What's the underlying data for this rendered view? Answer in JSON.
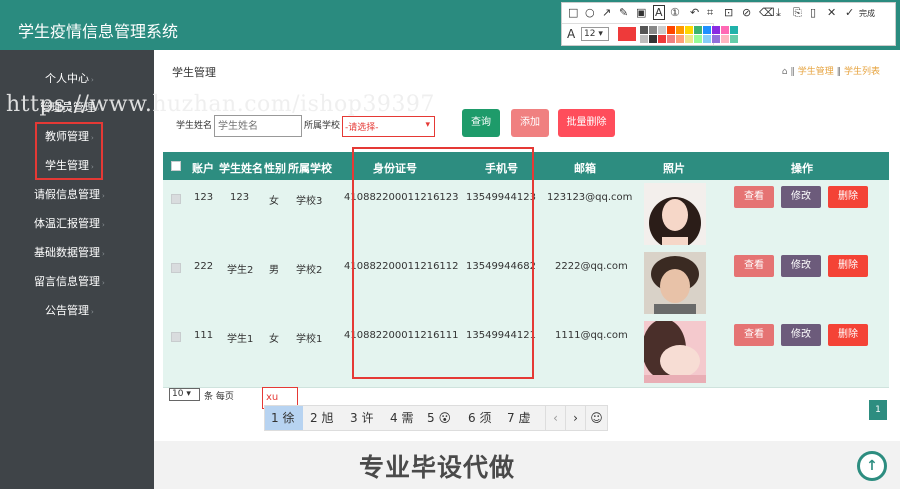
{
  "header": {
    "title": "学生疫情信息管理系统"
  },
  "toolbar": {
    "font_size": "12",
    "done_label": "完成",
    "icons": [
      "rect-icon",
      "circle-icon",
      "arrow-icon",
      "pen-icon",
      "mosaic-icon",
      "text-icon",
      "step-icon",
      "undo-icon",
      "crop-icon",
      "pin-icon",
      "clear-icon",
      "eraser-icon",
      "download-icon",
      "copy-icon",
      "phone-icon",
      "close-icon",
      "check-icon"
    ],
    "colors": [
      "#ee3a3a",
      "#555555",
      "#888888",
      "#cccccc",
      "#ff4500",
      "#ff9900",
      "#ffd700",
      "#3cb371",
      "#1e90ff",
      "#8a2be2",
      "#ff69b4",
      "#20b2aa",
      "#bdbdbd",
      "#333333",
      "#ee3a3a",
      "#f08080",
      "#ffa07a",
      "#f0e68c",
      "#98fb98",
      "#87cefa",
      "#9370db",
      "#ffb6c1",
      "#66cdaa"
    ]
  },
  "sidebar": {
    "items": [
      {
        "label": "个人中心"
      },
      {
        "label": "管理员管理"
      },
      {
        "label": "教师管理"
      },
      {
        "label": "学生管理"
      },
      {
        "label": "请假信息管理"
      },
      {
        "label": "体温汇报管理"
      },
      {
        "label": "基础数据管理"
      },
      {
        "label": "留言信息管理"
      },
      {
        "label": "公告管理"
      }
    ]
  },
  "watermark": "https://www.huzhan.com/ishop39397",
  "main": {
    "title": "学生管理",
    "breadcrumb": {
      "home": "⌂",
      "sep": "‖",
      "link1": "学生管理",
      "link2": "学生列表"
    },
    "filter": {
      "name_label": "学生姓名",
      "name_placeholder": "学生姓名",
      "school_label": "所属学校",
      "school_value": "-请选择-"
    },
    "buttons": {
      "query": "查询",
      "add": "添加",
      "batch_delete": "批量删除"
    },
    "table": {
      "headers": [
        "账户",
        "学生姓名",
        "性别",
        "所属学校",
        "身份证号",
        "手机号",
        "邮箱",
        "照片",
        "操作"
      ],
      "actions": {
        "view": "查看",
        "edit": "修改",
        "delete": "删除"
      },
      "rows": [
        {
          "account": "123",
          "name": "123",
          "gender": "女",
          "school": "学校3",
          "id_card": "410882200011216123",
          "phone": "13549944123",
          "email": "123123@qq.com"
        },
        {
          "account": "222",
          "name": "学生2",
          "gender": "男",
          "school": "学校2",
          "id_card": "410882200011216112",
          "phone": "13549944682",
          "email": "2222@qq.com"
        },
        {
          "account": "111",
          "name": "学生1",
          "gender": "女",
          "school": "学校1",
          "id_card": "410882200011216111",
          "phone": "13549944121",
          "email": "1111@qq.com"
        }
      ]
    },
    "pagination": {
      "page_size": "10",
      "per_page_label": "条 每页",
      "current_page": "1"
    },
    "ime": {
      "input": "xu",
      "candidates": [
        "1 徐",
        "2 旭",
        "3 许",
        "4 需",
        "5 😮",
        "6 须",
        "7 虚"
      ],
      "prev": "‹",
      "next": "›",
      "emoji": "☺"
    },
    "banner": "专业毕设代做"
  },
  "colors": {
    "accent": "#2d8d80",
    "query_btn": "#1e9b6a",
    "add_btn": "#f08080",
    "batch_btn": "#ff4d5b",
    "view_btn": "#e57373",
    "edit_btn": "#6c5b7b",
    "delete_btn": "#f44336"
  }
}
